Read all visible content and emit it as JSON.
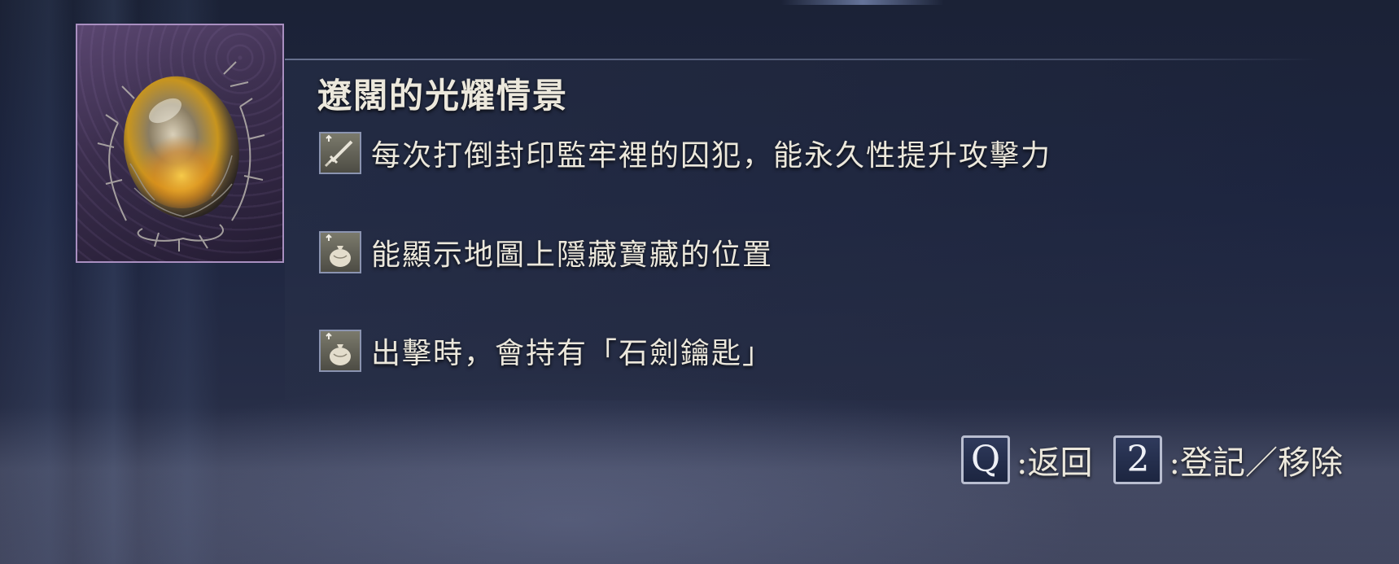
{
  "item": {
    "name": "遼闊的光耀情景",
    "image_icon": "radiant-egg-in-thorns-icon"
  },
  "effects": [
    {
      "icon": "sword-stat-up-icon",
      "text": "每次打倒封印監牢裡的囚犯，能永久性提升攻擊力"
    },
    {
      "icon": "pouch-stat-up-icon",
      "text": "能顯示地圖上隱藏寶藏的位置"
    },
    {
      "icon": "pouch-stat-up-icon",
      "text": "出擊時，會持有「石劍鑰匙」"
    }
  ],
  "controls": {
    "back": {
      "key": "Q",
      "label": ":返回"
    },
    "register": {
      "key": "2",
      "label": ":登記／移除"
    }
  },
  "colors": {
    "frame_border": "#a98fc0",
    "key_border": "#b9bed0",
    "text": "#ece8dc"
  }
}
